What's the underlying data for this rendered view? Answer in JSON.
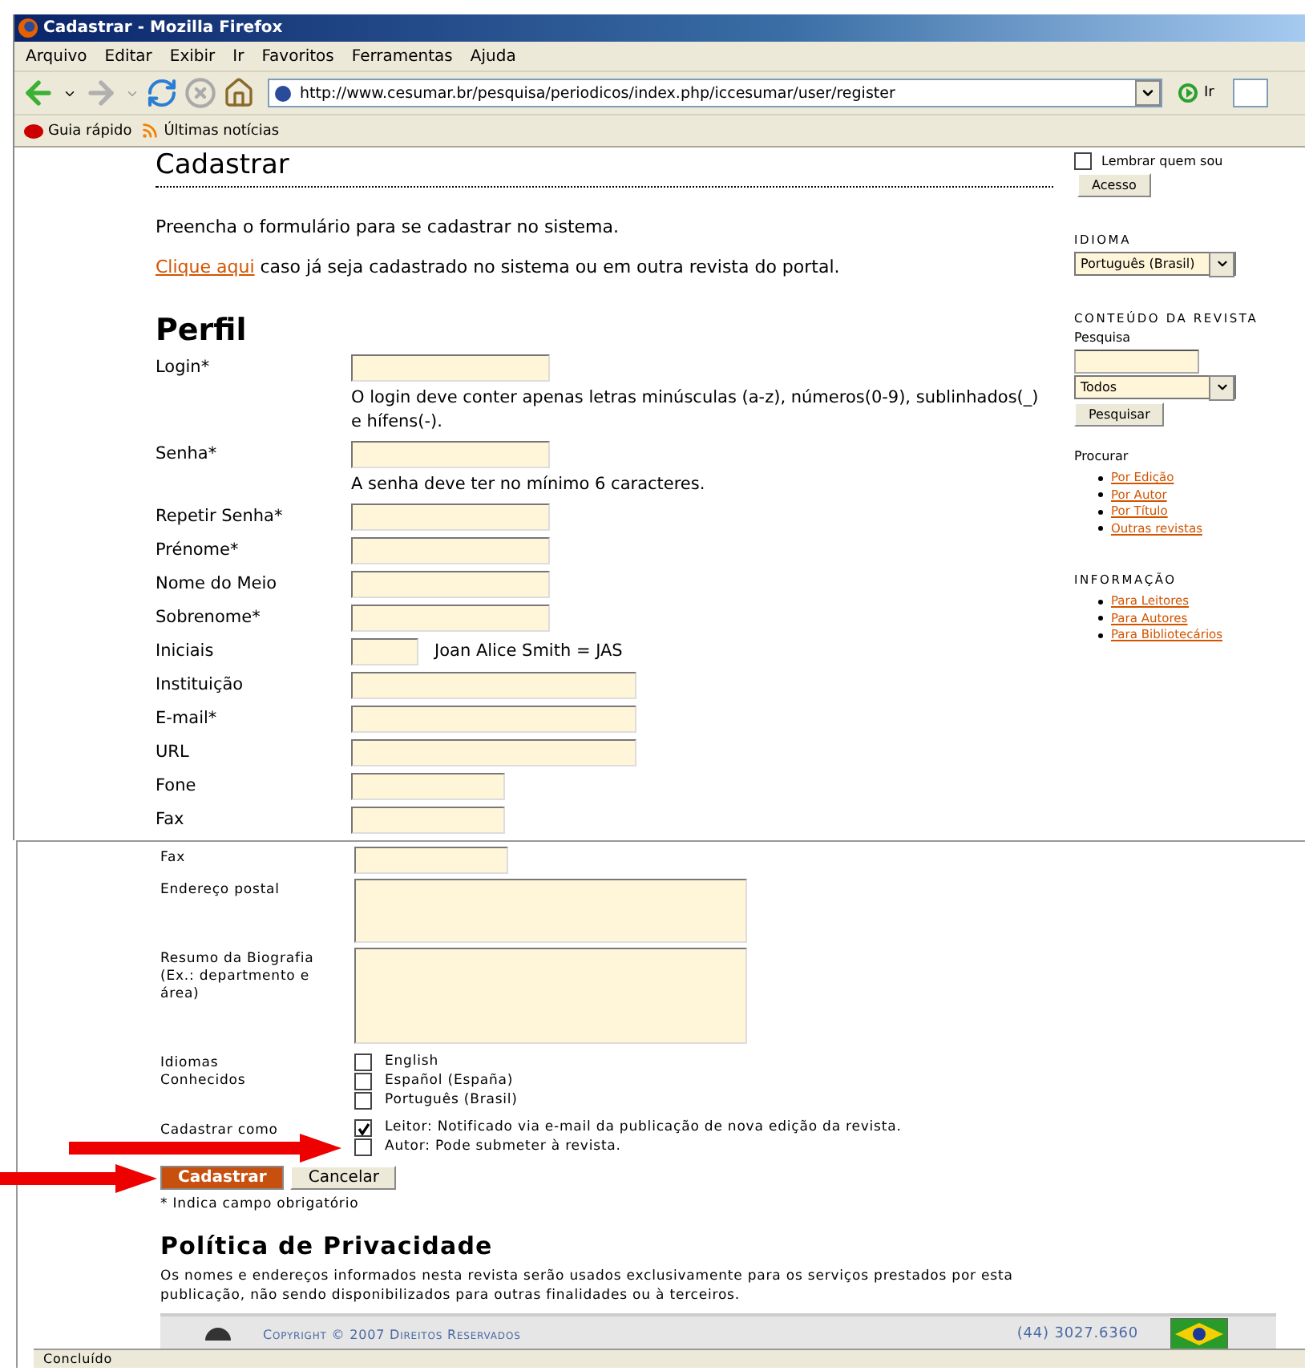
{
  "window": {
    "title": "Cadastrar - Mozilla Firefox"
  },
  "menu": [
    "Arquivo",
    "Editar",
    "Exibir",
    "Ir",
    "Favoritos",
    "Ferramentas",
    "Ajuda"
  ],
  "address_bar": {
    "url": "http://www.cesumar.br/pesquisa/periodicos/index.php/iccesumar/user/register",
    "go_label": "Ir"
  },
  "bookmarks": [
    "Guia rápido",
    "Últimas notícias"
  ],
  "page": {
    "heading": "Cadastrar",
    "intro": "Preencha o formulário para se cadastrar no sistema.",
    "login_link": "Clique aqui",
    "login_rest": " caso já seja cadastrado no sistema ou em outra revista do portal.",
    "section": "Perfil",
    "fields": [
      {
        "label": "Login*",
        "kind": "medium",
        "hint": "O login deve conter apenas letras minúsculas (a-z), números(0-9), sublinhados(_) e hífens(-)."
      },
      {
        "label": "Senha*",
        "kind": "medium",
        "hint": "A senha deve ter no mínimo 6 caracteres."
      },
      {
        "label": "Repetir Senha*",
        "kind": "medium"
      },
      {
        "label": "Prénome*",
        "kind": "medium"
      },
      {
        "label": "Nome do Meio",
        "kind": "medium"
      },
      {
        "label": "Sobrenome*",
        "kind": "medium"
      },
      {
        "label": "Iniciais",
        "kind": "tiny",
        "note": "Joan Alice Smith = JAS"
      },
      {
        "label": "Instituição",
        "kind": "wide"
      },
      {
        "label": "E-mail*",
        "kind": "wide"
      },
      {
        "label": "URL",
        "kind": "wide"
      },
      {
        "label": "Fone",
        "kind": "short"
      },
      {
        "label": "Fax",
        "kind": "short"
      }
    ]
  },
  "sidebar": {
    "remember": {
      "label": "Lembrar quem sou",
      "checked": false
    },
    "login_button": "Acesso",
    "language_title": "IDIOMA",
    "language_value": "Português (Brasil)",
    "content_title": "CONTEÚDO DA REVISTA",
    "search_label": "Pesquisa",
    "search_scope": "Todos",
    "search_button": "Pesquisar",
    "browse_title": "Procurar",
    "browse_links": [
      "Por Edição",
      "Por Autor",
      "Por Título",
      "Outras revistas"
    ],
    "info_title": "INFORMAÇÃO",
    "info_links": [
      "Para Leitores",
      "Para Autores",
      "Para Bibliotecários"
    ]
  },
  "lower": {
    "fields": [
      {
        "label": "Fax",
        "kind": "short"
      },
      {
        "label": "Endereço postal",
        "kind": "area"
      },
      {
        "label": "Resumo da Biografia (Ex.: departmento e área)",
        "kind": "tallarea"
      }
    ],
    "languages_label": "Idiomas Conhecidos",
    "languages": [
      {
        "label": "English",
        "checked": false
      },
      {
        "label": "Español (España)",
        "checked": false
      },
      {
        "label": "Português (Brasil)",
        "checked": false
      }
    ],
    "roles_label": "Cadastrar como",
    "roles": [
      {
        "label": "Leitor: Notificado via e-mail da publicação de nova edição da revista.",
        "checked": true
      },
      {
        "label": "Autor: Pode submeter à revista.",
        "checked": false
      }
    ],
    "submit": "Cadastrar",
    "cancel": "Cancelar",
    "required_note": "* Indica campo obrigatório",
    "privacy_title": "Política de Privacidade",
    "privacy_text": "Os nomes e endereços informados nesta revista serão usados exclusivamente para os serviços prestados por esta publicação, não sendo disponibilizados para outras finalidades ou à terceiros.",
    "copyright": "Copyright © 2007 Direitos Reservados",
    "phone": "(44) 3027.6360"
  },
  "status_bar": "Concluído"
}
